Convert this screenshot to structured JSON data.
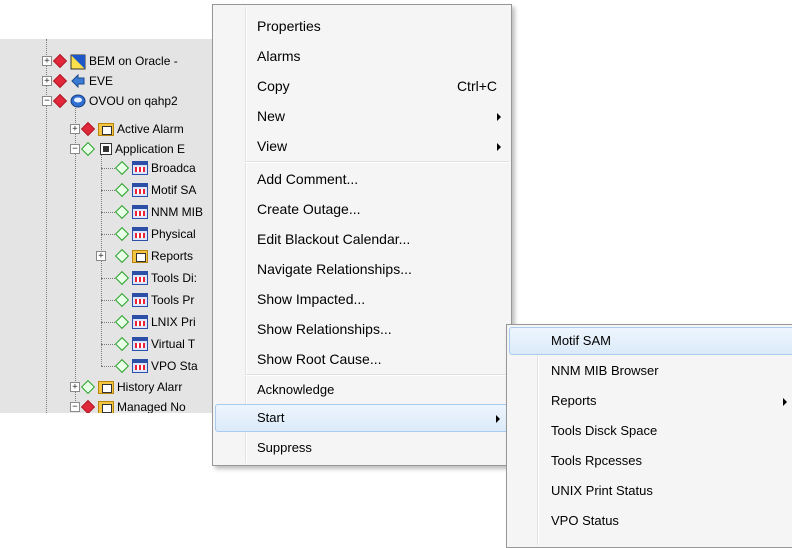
{
  "tree": {
    "items": [
      {
        "label": "BEM on Oracle - "
      },
      {
        "label": "EVE"
      },
      {
        "label": "OVOU on qahp2"
      },
      {
        "label": "Active Alarm"
      },
      {
        "label": "Application E"
      },
      {
        "label": "Broadca"
      },
      {
        "label": "Motif SA"
      },
      {
        "label": "NNM MIB"
      },
      {
        "label": "Physical"
      },
      {
        "label": "Reports"
      },
      {
        "label": "Tools Di:"
      },
      {
        "label": "Tools Pr"
      },
      {
        "label": "LNIX Pri"
      },
      {
        "label": "Virtual T"
      },
      {
        "label": "VPO Sta"
      },
      {
        "label": "History Alarr"
      },
      {
        "label": "Managed No"
      }
    ]
  },
  "context_menu": {
    "items": [
      {
        "label": "Properties"
      },
      {
        "label": "Alarms"
      },
      {
        "label": "Copy",
        "shortcut": "Ctrl+C"
      },
      {
        "label": "New"
      },
      {
        "label": "View"
      },
      {
        "label": "Add Comment..."
      },
      {
        "label": "Create Outage..."
      },
      {
        "label": "Edit Blackout Calendar..."
      },
      {
        "label": "Navigate Relationships..."
      },
      {
        "label": "Show Impacted..."
      },
      {
        "label": "Show Relationships..."
      },
      {
        "label": "Show Root Cause..."
      },
      {
        "label": "Acknowledge"
      },
      {
        "label": "Start"
      },
      {
        "label": "Suppress"
      }
    ]
  },
  "submenu": {
    "items": [
      {
        "label": "Motif SAM"
      },
      {
        "label": "NNM MIB Browser"
      },
      {
        "label": "Reports"
      },
      {
        "label": "Tools Disck Space"
      },
      {
        "label": "Tools Rpcesses"
      },
      {
        "label": "UNIX Print Status"
      },
      {
        "label": "VPO Status"
      }
    ]
  },
  "colors": {
    "status_red": "#e0283a",
    "status_green": "#2aa02a",
    "highlight": "#dbeaf9"
  }
}
